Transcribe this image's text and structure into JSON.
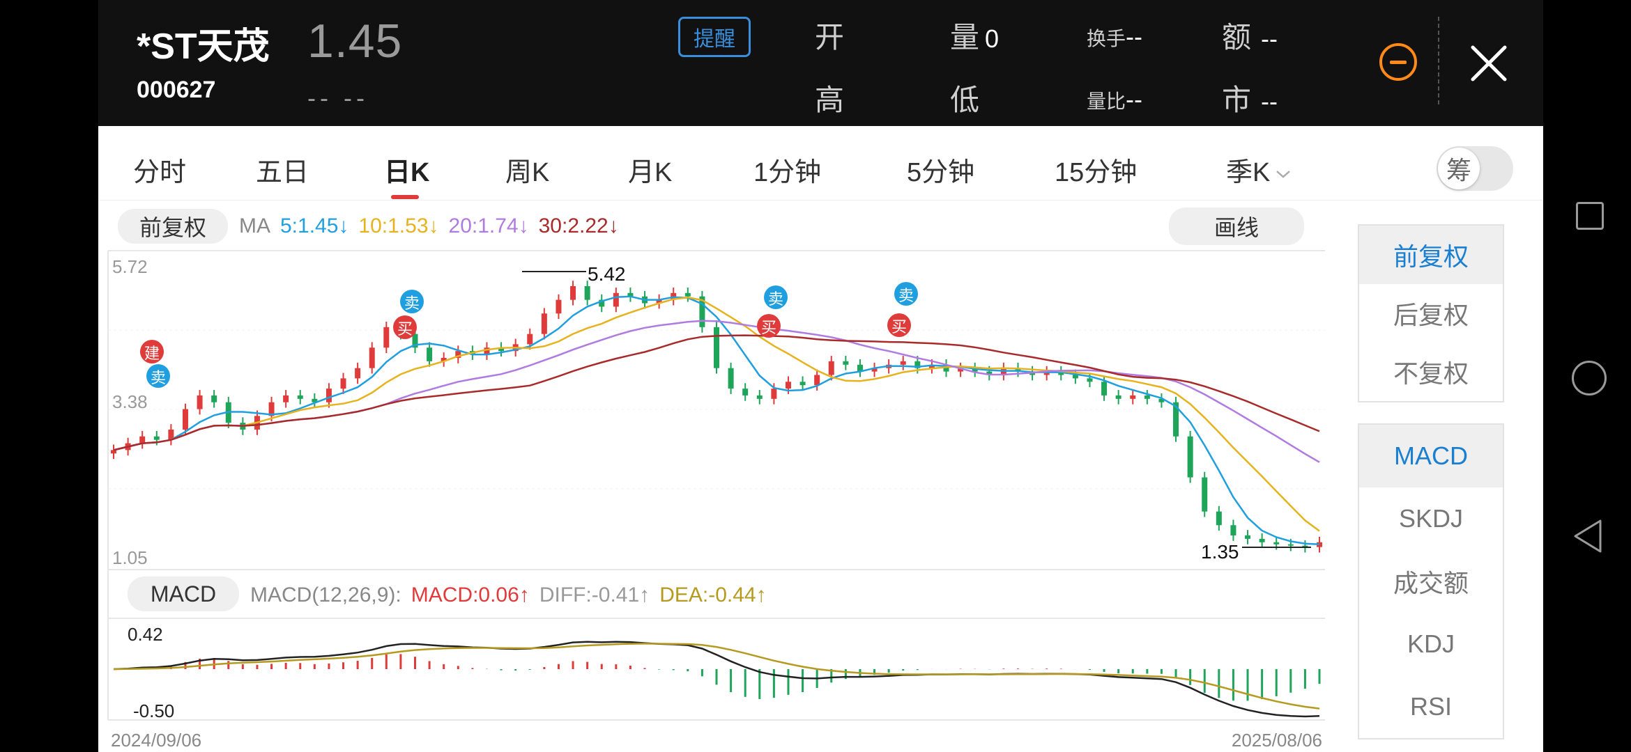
{
  "header": {
    "name": "*ST天茂",
    "code": "000627",
    "price": "1.45",
    "change": "-- --",
    "remind_label": "提醒",
    "open_label": "开",
    "high_label": "高",
    "volume_label": "量",
    "volume_value": "0",
    "low_label": "低",
    "turnover_label": "换手",
    "turnover_value": "--",
    "volume_ratio_label": "量比",
    "volume_ratio_value": "--",
    "amount_label": "额",
    "amount_value": "--",
    "market_cap_label": "市",
    "market_cap_value": "--"
  },
  "tabs": [
    "分时",
    "五日",
    "日K",
    "周K",
    "月K",
    "1分钟",
    "5分钟",
    "15分钟",
    "季K"
  ],
  "active_tab": "日K",
  "toggle_label": "筹",
  "chart": {
    "adjust_label": "前复权",
    "ma_label": "MA",
    "ma5": "5:1.45↓",
    "ma10": "10:1.53↓",
    "ma20": "20:1.74↓",
    "ma30": "30:2.22↓",
    "draw_label": "画线",
    "y_top": "5.72",
    "y_mid": "3.38",
    "y_bottom": "1.05",
    "high_mark": "5.42",
    "low_mark": "1.35",
    "macd_btn": "MACD",
    "macd_param": "MACD(12,26,9):",
    "macd_val": "MACD:0.06↑",
    "diff_val": "DIFF:-0.41↑",
    "dea_val": "DEA:-0.44↑",
    "macd_top": "0.42",
    "macd_bottom": "-0.50",
    "date_start": "2024/09/06",
    "date_end": "2025/08/06",
    "signal_jian": "建",
    "signal_mai": "买",
    "signal_sell": "卖"
  },
  "side_panel": {
    "adjust_options": [
      "前复权",
      "后复权",
      "不复权"
    ],
    "indicator_options": [
      "MACD",
      "SKDJ",
      "成交额",
      "KDJ",
      "RSI"
    ]
  },
  "colors": {
    "up": "#e03b3b",
    "down": "#1ea55a",
    "ma5": "#1f9fe0",
    "ma10": "#e6b31e",
    "ma20": "#b07be0",
    "ma30": "#a82a2a",
    "accent": "#1b7fd1",
    "orange": "#ff8a1a"
  },
  "chart_data": {
    "type": "candlestick",
    "x_range": [
      "2024/09/06",
      "2025/08/06"
    ],
    "ylim": [
      1.05,
      5.72
    ],
    "y_ticks": [
      5.72,
      3.38,
      1.05
    ],
    "highest": 5.42,
    "lowest": 1.35,
    "price_closes": [
      2.8,
      2.9,
      3.0,
      2.95,
      3.1,
      3.4,
      3.6,
      3.5,
      3.2,
      3.1,
      3.3,
      3.5,
      3.6,
      3.55,
      3.5,
      3.7,
      3.85,
      4.0,
      4.3,
      4.6,
      4.5,
      4.3,
      4.1,
      4.15,
      4.25,
      4.2,
      4.3,
      4.25,
      4.35,
      4.5,
      4.8,
      5.0,
      5.2,
      5.0,
      4.9,
      5.1,
      5.05,
      4.95,
      5.0,
      5.1,
      5.05,
      4.6,
      4.0,
      3.7,
      3.6,
      3.55,
      3.7,
      3.8,
      3.75,
      3.9,
      4.1,
      4.05,
      3.95,
      4.0,
      4.05,
      4.1,
      4.0,
      4.05,
      3.95,
      4.0,
      3.95,
      3.9,
      4.0,
      3.95,
      3.9,
      3.95,
      3.9,
      3.85,
      3.8,
      3.6,
      3.55,
      3.6,
      3.55,
      3.5,
      3.0,
      2.4,
      1.9,
      1.7,
      1.55,
      1.5,
      1.45,
      1.42,
      1.4,
      1.38,
      1.45
    ],
    "series": [
      {
        "name": "MA5",
        "last": 1.45
      },
      {
        "name": "MA10",
        "last": 1.53
      },
      {
        "name": "MA20",
        "last": 1.74
      },
      {
        "name": "MA30",
        "last": 2.22
      }
    ],
    "macd": {
      "params": "12,26,9",
      "macd": 0.06,
      "diff": -0.41,
      "dea": -0.44,
      "ylim": [
        -0.5,
        0.42
      ]
    }
  }
}
